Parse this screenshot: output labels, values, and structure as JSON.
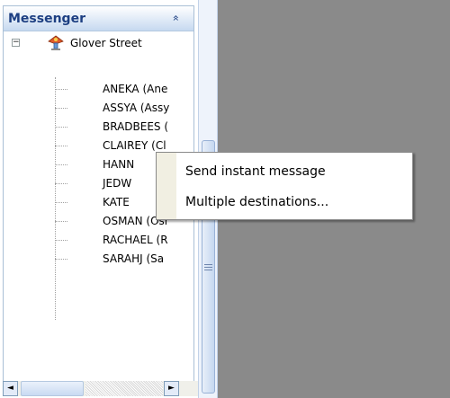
{
  "panel": {
    "title": "Messenger",
    "collapse_glyph": "»"
  },
  "tree": {
    "root": {
      "expander": "−",
      "label": "Glover Street",
      "icon": "network-node-icon"
    },
    "children": [
      {
        "label": "ANEKA (Ane"
      },
      {
        "label": "ASSYA (Assy"
      },
      {
        "label": "BRADBEES ("
      },
      {
        "label": "CLAIREY (Cl"
      },
      {
        "label": "HANN"
      },
      {
        "label": "JEDW"
      },
      {
        "label": "KATE"
      },
      {
        "label": "OSMAN (Osr"
      },
      {
        "label": "RACHAEL (R"
      },
      {
        "label": "SARAHJ (Sa"
      }
    ]
  },
  "scrollbars": {
    "left_arrow": "◄",
    "right_arrow": "►"
  },
  "context_menu": {
    "items": [
      {
        "label": "Send instant message"
      },
      {
        "label": "Multiple destinations..."
      }
    ]
  },
  "colors": {
    "header_text": "#1d3f82",
    "workspace": "#8a8a8a",
    "panel_border": "#a9bfd6"
  }
}
